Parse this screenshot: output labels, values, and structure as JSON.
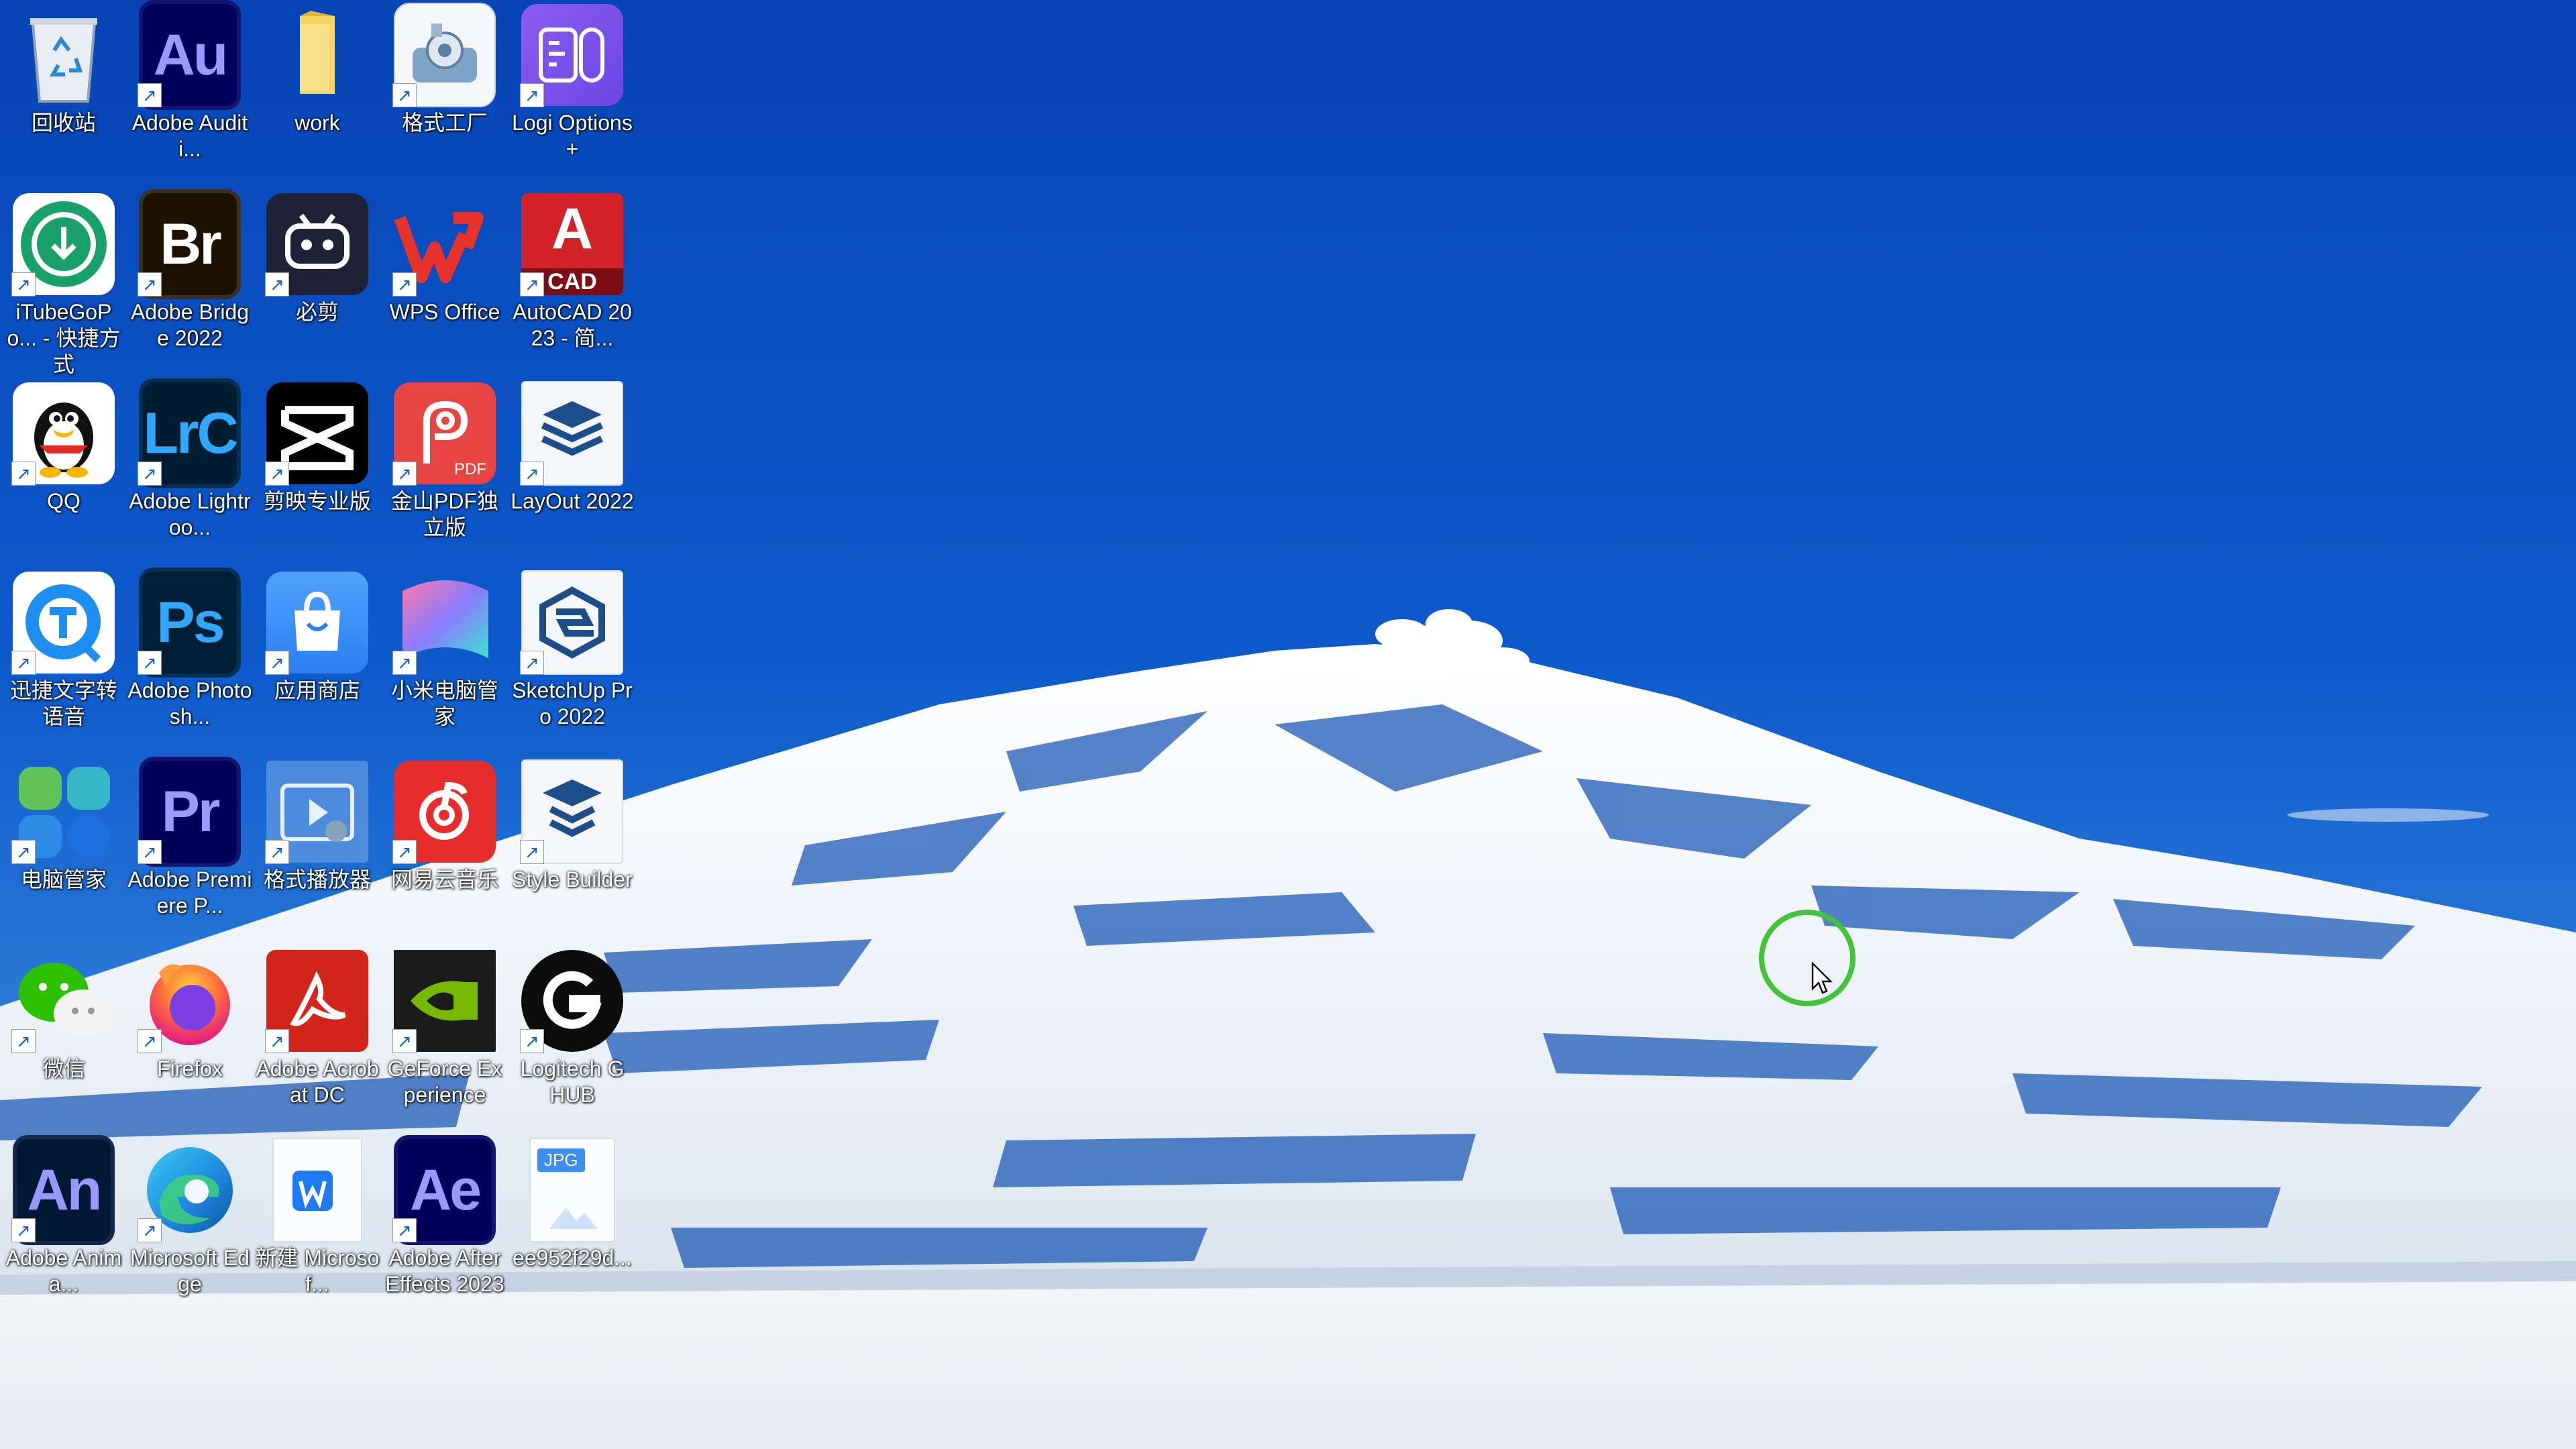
{
  "desktop": {
    "icons": [
      {
        "label": "回收站",
        "icon": "recycle-bin-icon"
      },
      {
        "label": "Adobe Auditi...",
        "icon": "adobe-audition-icon",
        "tile_text": "Au",
        "shortcut": true
      },
      {
        "label": "work",
        "icon": "folder-icon"
      },
      {
        "label": "格式工厂",
        "icon": "format-factory-icon",
        "shortcut": true
      },
      {
        "label": "Logi Options+",
        "icon": "logi-options-icon",
        "shortcut": true
      },
      {
        "label": "iTubeGoPo... - 快捷方式",
        "icon": "itubego-icon",
        "shortcut": true
      },
      {
        "label": "Adobe Bridge 2022",
        "icon": "adobe-bridge-icon",
        "tile_text": "Br",
        "shortcut": true
      },
      {
        "label": "必剪",
        "icon": "bijian-icon",
        "shortcut": true
      },
      {
        "label": "WPS Office",
        "icon": "wps-office-icon",
        "tile_text": "W",
        "shortcut": true
      },
      {
        "label": "AutoCAD 2023 - 简...",
        "icon": "autocad-icon",
        "tile_text": "A",
        "tile_sub": "CAD",
        "shortcut": true
      },
      {
        "label": "QQ",
        "icon": "qq-icon",
        "shortcut": true
      },
      {
        "label": "Adobe Lightroo...",
        "icon": "adobe-lightroom-classic-icon",
        "tile_text": "LrC",
        "shortcut": true
      },
      {
        "label": "剪映专业版",
        "icon": "capcut-icon",
        "shortcut": true
      },
      {
        "label": "金山PDF独立版",
        "icon": "kingsoft-pdf-icon",
        "tile_sub": "PDF",
        "shortcut": true
      },
      {
        "label": "LayOut 2022",
        "icon": "layout-icon",
        "shortcut": true
      },
      {
        "label": "迅捷文字转语音",
        "icon": "xunjie-tts-icon",
        "shortcut": true
      },
      {
        "label": "Adobe Photosh...",
        "icon": "adobe-photoshop-icon",
        "tile_text": "Ps",
        "shortcut": true
      },
      {
        "label": "应用商店",
        "icon": "app-store-icon",
        "shortcut": true
      },
      {
        "label": "小米电脑管家",
        "icon": "xiaomi-pc-manager-icon",
        "shortcut": true
      },
      {
        "label": "SketchUp Pro 2022",
        "icon": "sketchup-icon",
        "shortcut": true
      },
      {
        "label": "电脑管家",
        "icon": "pc-manager-icon",
        "shortcut": true
      },
      {
        "label": "Adobe Premiere P...",
        "icon": "adobe-premiere-icon",
        "tile_text": "Pr",
        "shortcut": true
      },
      {
        "label": "格式播放器",
        "icon": "format-player-icon",
        "shortcut": true
      },
      {
        "label": "网易云音乐",
        "icon": "netease-music-icon",
        "shortcut": true
      },
      {
        "label": "Style Builder",
        "icon": "style-builder-icon",
        "shortcut": true
      },
      {
        "label": "微信",
        "icon": "wechat-icon",
        "shortcut": true
      },
      {
        "label": "Firefox",
        "icon": "firefox-icon",
        "shortcut": true
      },
      {
        "label": "Adobe Acrobat DC",
        "icon": "adobe-acrobat-icon",
        "shortcut": true
      },
      {
        "label": "GeForce Experience",
        "icon": "geforce-experience-icon",
        "shortcut": true
      },
      {
        "label": "Logitech G HUB",
        "icon": "logitech-ghub-icon",
        "tile_text": "G",
        "shortcut": true
      },
      {
        "label": "Adobe Anima...",
        "icon": "adobe-animate-icon",
        "tile_text": "An",
        "shortcut": true
      },
      {
        "label": "Microsoft Edge",
        "icon": "edge-icon",
        "shortcut": true
      },
      {
        "label": "新建 Microsof...",
        "icon": "word-document-icon",
        "tile_text": "W"
      },
      {
        "label": "Adobe After Effects 2023",
        "icon": "adobe-after-effects-icon",
        "tile_text": "Ae",
        "shortcut": true
      },
      {
        "label": "ee952f29d...",
        "icon": "jpg-file-icon",
        "tile_sub": "JPG"
      }
    ]
  },
  "wallpaper": {
    "icon": "snowy-mountain-wallpaper"
  },
  "cursor": {
    "indicator": "cursor-highlight-ring",
    "pointer": "mouse-pointer-icon"
  },
  "colors": {
    "sky": "#0a4fc0",
    "snow": "#eef2f6",
    "highlight_ring": "#44c23a"
  }
}
